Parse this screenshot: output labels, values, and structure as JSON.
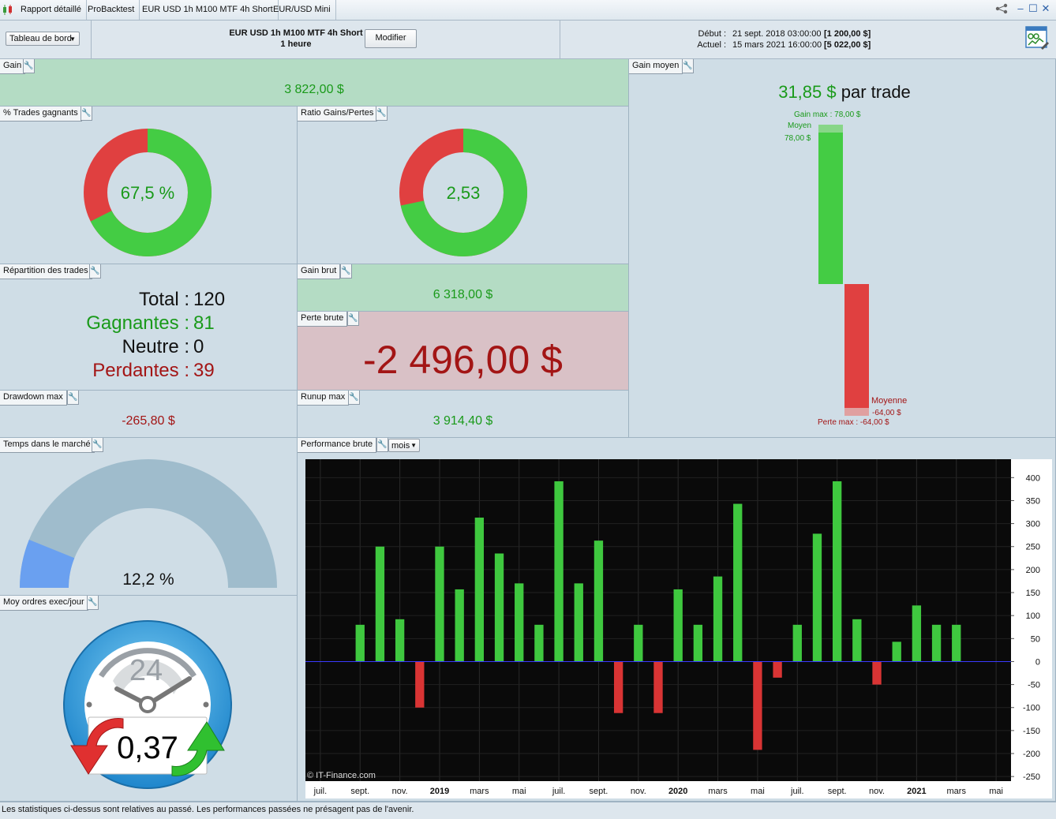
{
  "tabs": [
    {
      "label": "Rapport détaillé"
    },
    {
      "label": "ProBacktest"
    },
    {
      "label": "EUR USD 1h M100 MTF 4h Short"
    },
    {
      "label": "EUR/USD Mini"
    }
  ],
  "header": {
    "dashboard_select": "Tableau de bord",
    "strategy_name": "EUR USD 1h M100 MTF 4h Short",
    "timeframe": "1 heure",
    "modify_label": "Modifier",
    "start_label": "Début :",
    "start_date": "21 sept. 2018 03:00:00",
    "start_capital": "[1 200,00 $]",
    "current_label": "Actuel :",
    "current_date": "15 mars 2021 16:00:00",
    "current_capital": "[5 022,00 $]"
  },
  "gain": {
    "title": "Gain",
    "value": "3 822,00 $"
  },
  "win_rate": {
    "title": "% Trades gagnants",
    "text": "67,5 %",
    "fraction": 0.675
  },
  "ratio": {
    "title": "Ratio Gains/Pertes",
    "text": "2,53",
    "fraction": 0.717
  },
  "distribution": {
    "title": "Répartition des trades",
    "total_label": "Total :",
    "total": "120",
    "win_label": "Gagnantes :",
    "win": "81",
    "neutral_label": "Neutre :",
    "neutral": "0",
    "loss_label": "Perdantes :",
    "loss": "39"
  },
  "gross_gain": {
    "title": "Gain brut",
    "value": "6 318,00 $"
  },
  "gross_loss": {
    "title": "Perte brute",
    "value": "-2 496,00 $"
  },
  "drawdown": {
    "title": "Drawdown max",
    "value": "-265,80 $"
  },
  "runup": {
    "title": "Runup max",
    "value": "3 914,40 $"
  },
  "avg_gain": {
    "title": "Gain moyen",
    "value": "31,85 $",
    "suffix": "par trade",
    "gain_max_label": "Gain max : 78,00 $",
    "moyen_label": "Moyen",
    "moyen_value": "78,00 $",
    "moyenne_label": "Moyenne",
    "moyenne_value": "-64,00 $",
    "perte_max_label": "Perte max : -64,00 $"
  },
  "time_in_market": {
    "title": "Temps dans le marché",
    "text": "12,2 %",
    "fraction": 0.122
  },
  "orders_per_day": {
    "title": "Moy ordres exec/jour",
    "dial_label": "24",
    "value": "0,37"
  },
  "performance": {
    "title": "Performance brute",
    "period_select": "mois",
    "watermark": "© IT-Finance.com"
  },
  "chart_data": {
    "type": "bar",
    "categories": [
      "2018-07",
      "2018-08",
      "2018-09",
      "2018-10",
      "2018-11",
      "2018-12",
      "2019-01",
      "2019-02",
      "2019-03",
      "2019-04",
      "2019-05",
      "2019-06",
      "2019-07",
      "2019-08",
      "2019-09",
      "2019-10",
      "2019-11",
      "2019-12",
      "2020-01",
      "2020-02",
      "2020-03",
      "2020-04",
      "2020-05",
      "2020-06",
      "2020-07",
      "2020-08",
      "2020-09",
      "2020-10",
      "2020-11",
      "2020-12",
      "2021-01",
      "2021-02",
      "2021-03",
      "2021-04",
      "2021-05"
    ],
    "values": [
      0,
      0,
      80,
      250,
      92,
      -100,
      250,
      157,
      313,
      235,
      170,
      80,
      392,
      170,
      263,
      -112,
      80,
      -112,
      157,
      80,
      185,
      343,
      -192,
      -35,
      80,
      278,
      392,
      92,
      -50,
      43,
      122,
      80,
      80,
      0,
      0
    ],
    "ylim": [
      -260,
      440
    ],
    "yticks": [
      400,
      350,
      300,
      250,
      200,
      150,
      100,
      50,
      0,
      -50,
      -100,
      -150,
      -200,
      -250
    ],
    "xtick_labels": [
      "juil.",
      "sept.",
      "nov.",
      "2019",
      "mars",
      "mai",
      "juil.",
      "sept.",
      "nov.",
      "2020",
      "mars",
      "mai",
      "juil.",
      "sept.",
      "nov.",
      "2021",
      "mars",
      "mai"
    ],
    "positive_color": "#3fc83f",
    "negative_color": "#d93434",
    "background": "#0a0a0a"
  },
  "footer": {
    "disclaimer": "Les statistiques ci-dessus sont relatives au passé. Les performances passées ne présagent pas de l'avenir."
  }
}
